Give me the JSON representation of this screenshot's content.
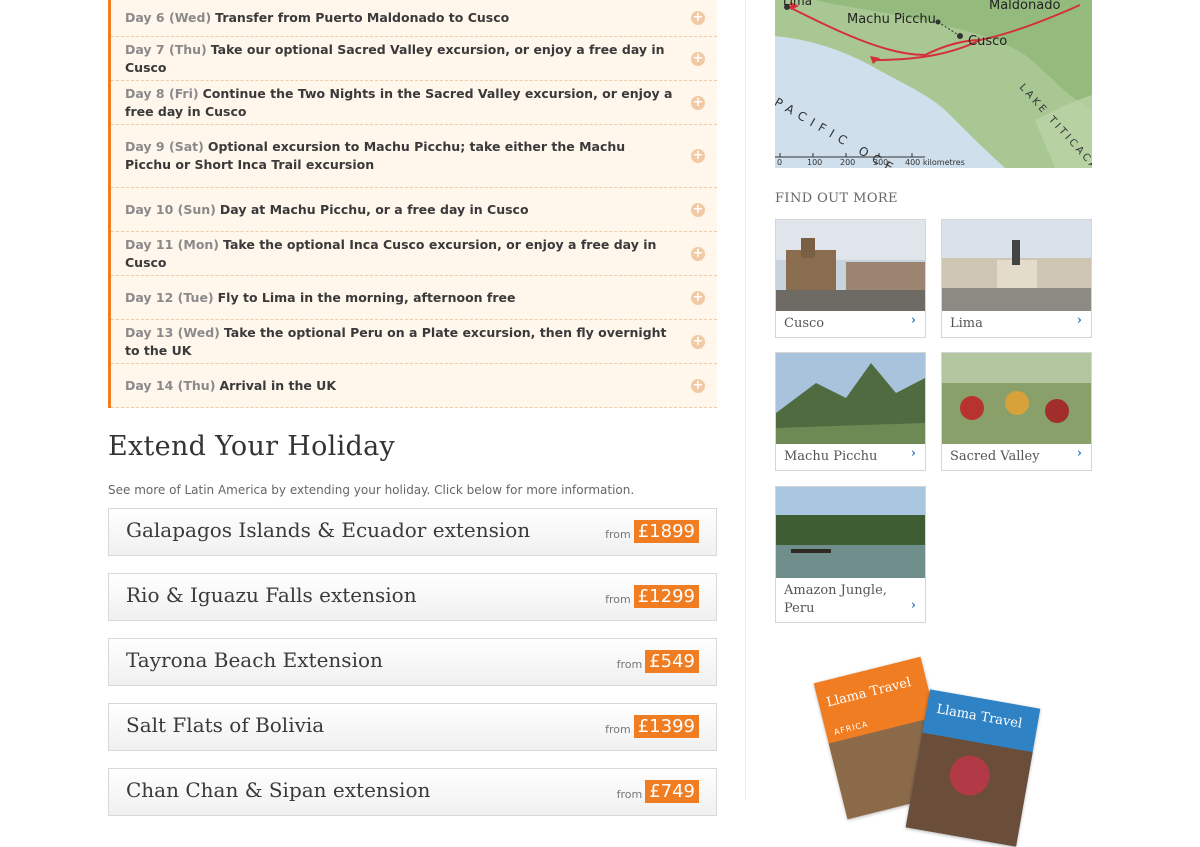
{
  "itinerary": [
    {
      "day": "Day 6 (Wed)",
      "text": "Transfer from Puerto Maldonado to Cusco"
    },
    {
      "day": "Day 7 (Thu)",
      "text": "Take our optional Sacred Valley excursion, or enjoy a free day in Cusco"
    },
    {
      "day": "Day 8 (Fri)",
      "text": "Continue the Two Nights in the Sacred Valley excursion, or enjoy a free day in Cusco"
    },
    {
      "day": "Day 9 (Sat)",
      "text": "Optional excursion to Machu Picchu; take either the Machu Picchu or Short Inca Trail excursion"
    },
    {
      "day": "Day 10 (Sun)",
      "text": "Day at Machu Picchu, or a free day in Cusco"
    },
    {
      "day": "Day 11 (Mon)",
      "text": "Take the optional Inca Cusco excursion, or enjoy a free day in Cusco"
    },
    {
      "day": "Day 12 (Tue)",
      "text": "Fly to Lima in the morning, afternoon free"
    },
    {
      "day": "Day 13 (Wed)",
      "text": "Take the optional Peru on a Plate excursion, then fly overnight to the UK"
    },
    {
      "day": "Day 14 (Thu)",
      "text": "Arrival in the UK"
    }
  ],
  "extend": {
    "title": "Extend Your Holiday",
    "description": "See more of Latin America by extending your holiday. Click below for more information.",
    "from_label": "from",
    "items": [
      {
        "name": "Galapagos Islands & Ecuador extension",
        "price": "£1899"
      },
      {
        "name": "Rio & Iguazu Falls extension",
        "price": "£1299"
      },
      {
        "name": "Tayrona Beach Extension",
        "price": "£549"
      },
      {
        "name": "Salt Flats of Bolivia",
        "price": "£1399"
      },
      {
        "name": "Chan Chan & Sipan extension",
        "price": "£749"
      }
    ]
  },
  "map": {
    "labels": {
      "lima": "Lima",
      "machu_picchu": "Machu Picchu",
      "maldonado": "Maldonado",
      "cusco": "Cusco",
      "ocean": "PACIFIC OCEAN",
      "lake": "LAKE TITICACA"
    },
    "scale": [
      "0",
      "100",
      "200",
      "300",
      "400 kilometres"
    ]
  },
  "find_out_more": {
    "title": "FIND OUT MORE",
    "tiles": [
      {
        "label": "Cusco"
      },
      {
        "label": "Lima"
      },
      {
        "label": "Machu Picchu"
      },
      {
        "label": "Sacred Valley"
      },
      {
        "label": "Amazon Jungle, Peru"
      }
    ]
  },
  "brochures": {
    "africa": {
      "brand": "Llama Travel",
      "sub": "AFRICA"
    },
    "latin": {
      "brand": "Llama Travel"
    }
  },
  "colors": {
    "accent": "#f07d22",
    "link": "#3a7bbf"
  }
}
